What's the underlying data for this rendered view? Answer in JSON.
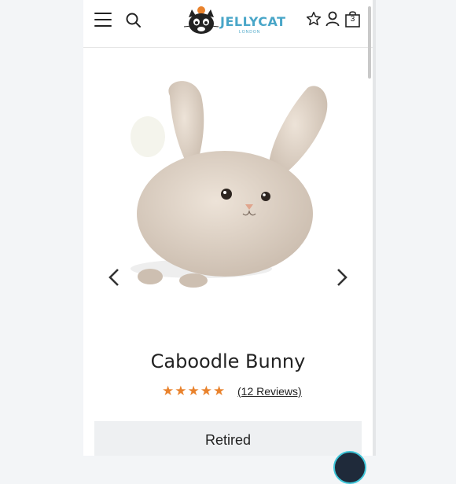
{
  "header": {
    "logo_text": "JELLYCAT",
    "logo_sub": "LONDON",
    "bag_count": "3",
    "icons": [
      "menu-icon",
      "search-icon",
      "star-icon",
      "user-icon",
      "bag-icon"
    ]
  },
  "product": {
    "title": "Caboodle Bunny",
    "rating": 5,
    "stars": "★★★★★",
    "reviews_label": "(12 Reviews)",
    "status": "Retired"
  },
  "colors": {
    "star": "#e9822c",
    "brand": "#49a6c8",
    "status_bg": "#eef0f2"
  }
}
